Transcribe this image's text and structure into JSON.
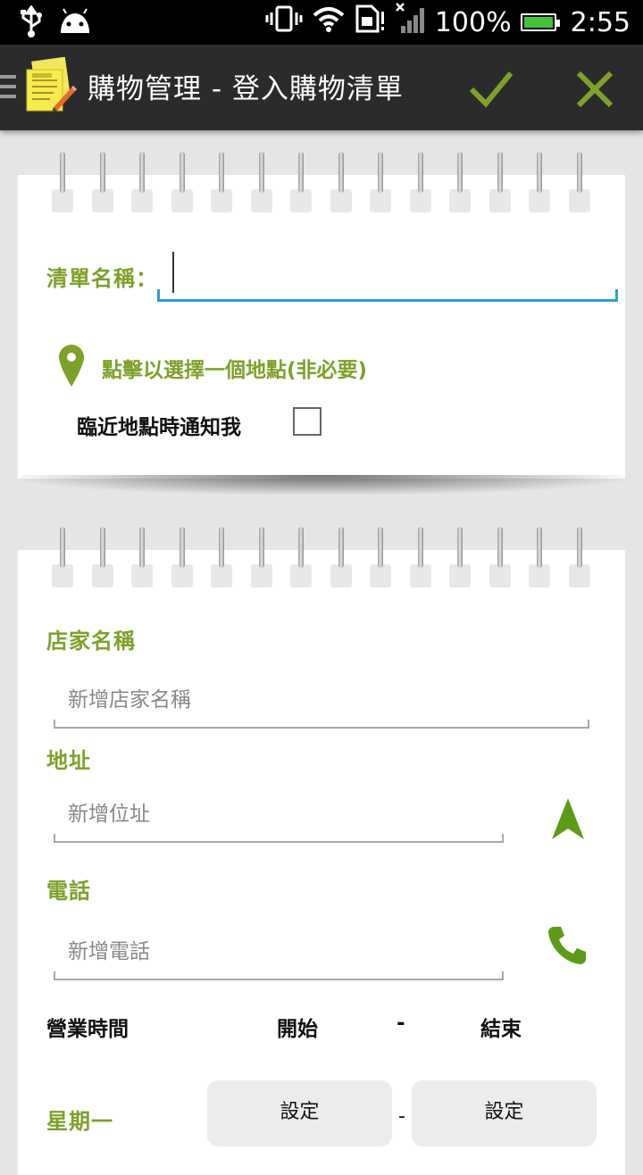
{
  "status_bar": {
    "battery_percent": "100%",
    "time": "2:55",
    "battery_color": "#43c23a"
  },
  "action_bar": {
    "title": "購物管理 - 登入購物清單",
    "confirm_icon": "check-icon",
    "cancel_icon": "close-icon",
    "accent": "#7ea12a"
  },
  "list_card": {
    "name_label": "清單名稱：",
    "name_value": "",
    "location_link": "點擊以選擇一個地點(非必要)",
    "notify_label": "臨近地點時通知我",
    "notify_checked": false
  },
  "store_card": {
    "store_label": "店家名稱",
    "store_placeholder": "新增店家名稱",
    "address_label": "地址",
    "address_placeholder": "新增位址",
    "phone_label": "電話",
    "phone_placeholder": "新增電話",
    "hours": {
      "label": "營業時間",
      "start": "開始",
      "separator": "-",
      "end": "結束"
    },
    "days": [
      {
        "day": "星期一",
        "start_button": "設定",
        "separator": "-",
        "end_button": "設定"
      }
    ]
  }
}
